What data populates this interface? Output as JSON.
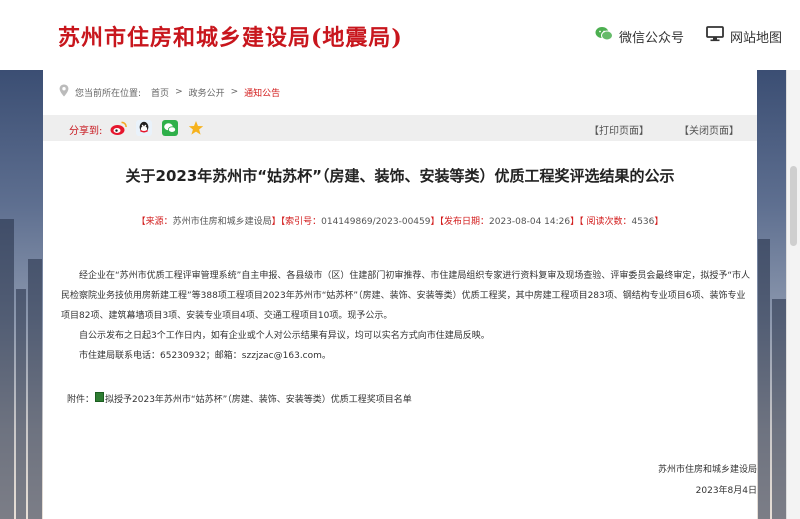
{
  "header": {
    "site_title": "苏州市住房和城乡建设局(地震局)",
    "wechat_label": "微信公众号",
    "sitemap_label": "网站地图"
  },
  "breadcrumb": {
    "prefix": "您当前所在位置:",
    "home": "首页",
    "sep1": ">",
    "section": "政务公开",
    "sep2": ">",
    "current": "通知公告"
  },
  "share": {
    "label": "分享到:",
    "icons": [
      "weibo-icon",
      "qq-icon",
      "wechat-icon",
      "favorite-star-icon"
    ]
  },
  "actions": {
    "print": "【打印页面】",
    "close": "【关闭页面】"
  },
  "article": {
    "title": "关于2023年苏州市“姑苏杯”（房建、装饰、安装等类）优质工程奖评选结果的公示",
    "meta": {
      "source_label": "【来源：",
      "source_value": "苏州市住房和城乡建设局",
      "index_label": "】【索引号：",
      "index_value": "014149869/2023-00459",
      "date_label": "】【发布日期：",
      "date_value": "2023-08-04 14:26",
      "views_label": "】【 阅读次数：",
      "views_value": "4536",
      "end": "】"
    },
    "paragraphs": [
      "经企业在“苏州市优质工程评审管理系统”自主申报、各县级市（区）住建部门初审推荐、市住建局组织专家进行资料复审及现场查验、评审委员会最终审定，拟授予“市人民检察院业务技侦用房新建工程”等388项工程项目2023年苏州市“姑苏杯”（房建、装饰、安装等类）优质工程奖，其中房建工程项目283项、钢结构专业项目6项、装饰专业项目82项、建筑幕墙项目3项、安装专业项目4项、交通工程项目10项。现予公示。",
      "自公示发布之日起3个工作日内，如有企业或个人对公示结果有异议，均可以实名方式向市住建局反映。",
      "市住建局联系电话：65230932；邮箱：szzjzac@163.com。"
    ],
    "attachment_label": "附件：",
    "attachment_name": "拟授予2023年苏州市“姑苏杯”（房建、装饰、安装等类）优质工程奖项目名单",
    "signature_org": "苏州市住房和城乡建设局",
    "signature_date": "2023年8月4日"
  },
  "colors": {
    "brand_red": "#c8161d",
    "highlight_red": "#d21b1b",
    "bar_gray": "#eeeeee"
  }
}
